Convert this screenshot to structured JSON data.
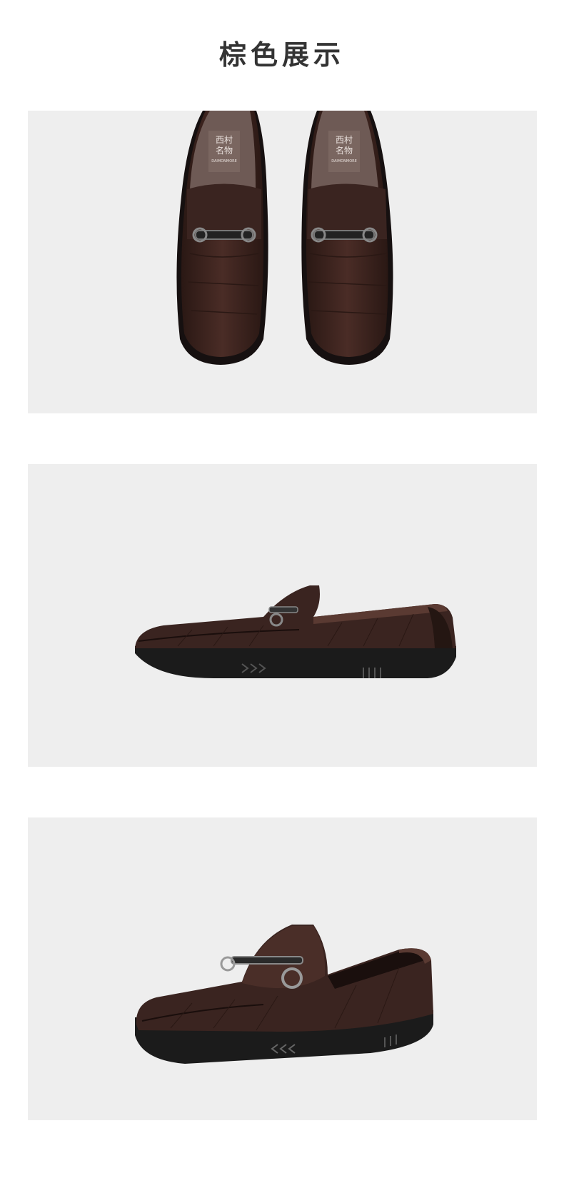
{
  "page": {
    "title": "棕色展示"
  },
  "insole_logo": {
    "line1": "西村",
    "line2": "名物",
    "line3": "DAIMONMORE"
  },
  "colors": {
    "panel_bg": "#eeeeee",
    "leather": "#3a2420",
    "leather_light": "#5a3a32",
    "sole": "#1b1b1b",
    "insole": "#6e5a55"
  },
  "photos": [
    {
      "view": "top-pair"
    },
    {
      "view": "side"
    },
    {
      "view": "three-quarter"
    }
  ]
}
